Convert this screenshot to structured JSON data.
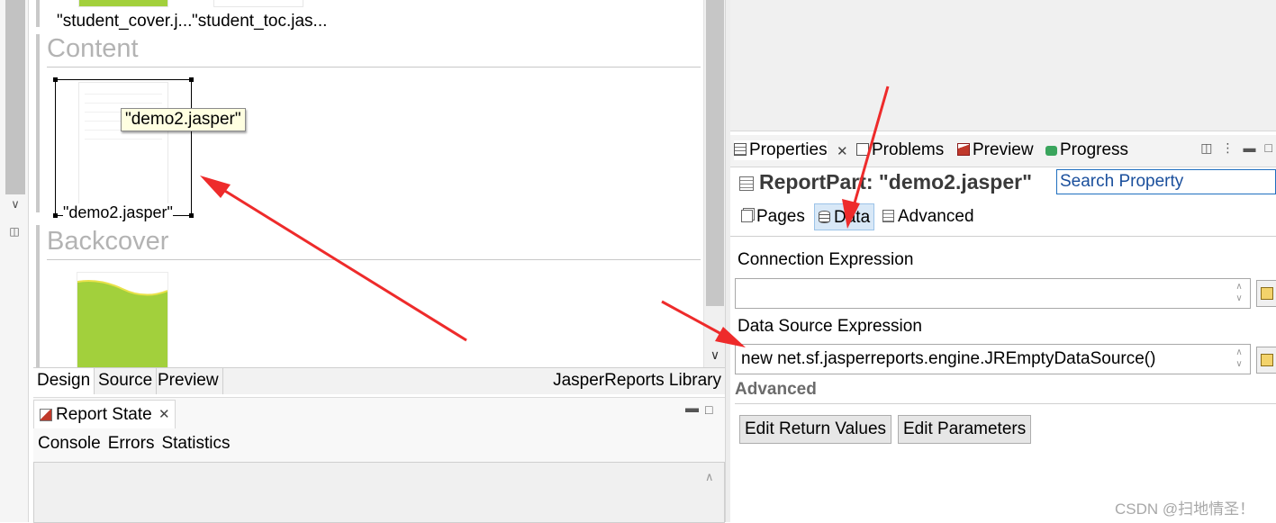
{
  "canvas": {
    "top_labels": [
      "\"student_cover.j...",
      "\"student_toc.jas..."
    ],
    "bands": {
      "content": "Content",
      "backcover": "Backcover"
    },
    "selected_part": {
      "tooltip": "\"demo2.jasper\"",
      "label": "\"demo2.jasper\""
    }
  },
  "editor_tabs": {
    "tabs": [
      "Design",
      "Source",
      "Preview"
    ],
    "active": "Design",
    "library": "JasperReports Library"
  },
  "report_state": {
    "title": "Report State",
    "toolbar": [
      "Console",
      "Errors",
      "Statistics"
    ]
  },
  "properties_view": {
    "tabs": {
      "properties": "Properties",
      "problems": "Problems",
      "preview": "Preview",
      "progress": "Progress"
    },
    "header_title": "ReportPart: \"demo2.jasper\"",
    "search_placeholder": "Search Property",
    "subtabs": {
      "pages": "Pages",
      "data": "Data",
      "advanced": "Advanced"
    },
    "active_subtab": "Data",
    "connection_expression": {
      "label": "Connection Expression",
      "value": ""
    },
    "data_source_expression": {
      "label": "Data Source Expression",
      "value": "new net.sf.jasperreports.engine.JREmptyDataSource()"
    },
    "advanced_section": "Advanced",
    "buttons": {
      "edit_return_values": "Edit Return Values",
      "edit_parameters": "Edit Parameters"
    }
  },
  "watermark": "CSDN @扫地情圣！",
  "colors": {
    "accent_selection": "#d8e8f7",
    "annotation_arrow": "#ee2b2b",
    "thumbnail_green": "#a2d03c",
    "search_border": "#1f6fbf"
  }
}
